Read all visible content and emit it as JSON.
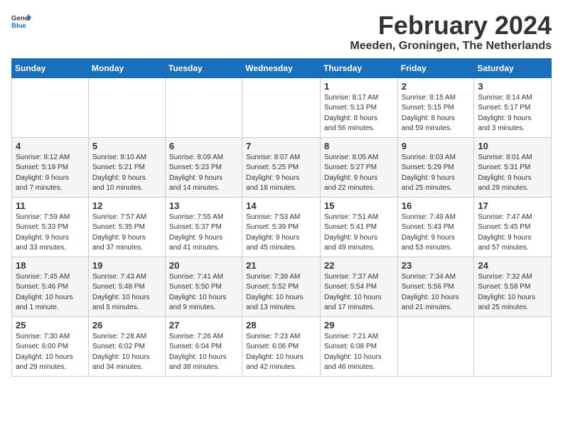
{
  "logo": {
    "general": "General",
    "blue": "Blue"
  },
  "title": "February 2024",
  "subtitle": "Meeden, Groningen, The Netherlands",
  "days_header": [
    "Sunday",
    "Monday",
    "Tuesday",
    "Wednesday",
    "Thursday",
    "Friday",
    "Saturday"
  ],
  "weeks": [
    [
      {
        "num": "",
        "info": ""
      },
      {
        "num": "",
        "info": ""
      },
      {
        "num": "",
        "info": ""
      },
      {
        "num": "",
        "info": ""
      },
      {
        "num": "1",
        "info": "Sunrise: 8:17 AM\nSunset: 5:13 PM\nDaylight: 8 hours\nand 56 minutes."
      },
      {
        "num": "2",
        "info": "Sunrise: 8:15 AM\nSunset: 5:15 PM\nDaylight: 8 hours\nand 59 minutes."
      },
      {
        "num": "3",
        "info": "Sunrise: 8:14 AM\nSunset: 5:17 PM\nDaylight: 9 hours\nand 3 minutes."
      }
    ],
    [
      {
        "num": "4",
        "info": "Sunrise: 8:12 AM\nSunset: 5:19 PM\nDaylight: 9 hours\nand 7 minutes."
      },
      {
        "num": "5",
        "info": "Sunrise: 8:10 AM\nSunset: 5:21 PM\nDaylight: 9 hours\nand 10 minutes."
      },
      {
        "num": "6",
        "info": "Sunrise: 8:09 AM\nSunset: 5:23 PM\nDaylight: 9 hours\nand 14 minutes."
      },
      {
        "num": "7",
        "info": "Sunrise: 8:07 AM\nSunset: 5:25 PM\nDaylight: 9 hours\nand 18 minutes."
      },
      {
        "num": "8",
        "info": "Sunrise: 8:05 AM\nSunset: 5:27 PM\nDaylight: 9 hours\nand 22 minutes."
      },
      {
        "num": "9",
        "info": "Sunrise: 8:03 AM\nSunset: 5:29 PM\nDaylight: 9 hours\nand 25 minutes."
      },
      {
        "num": "10",
        "info": "Sunrise: 8:01 AM\nSunset: 5:31 PM\nDaylight: 9 hours\nand 29 minutes."
      }
    ],
    [
      {
        "num": "11",
        "info": "Sunrise: 7:59 AM\nSunset: 5:33 PM\nDaylight: 9 hours\nand 33 minutes."
      },
      {
        "num": "12",
        "info": "Sunrise: 7:57 AM\nSunset: 5:35 PM\nDaylight: 9 hours\nand 37 minutes."
      },
      {
        "num": "13",
        "info": "Sunrise: 7:55 AM\nSunset: 5:37 PM\nDaylight: 9 hours\nand 41 minutes."
      },
      {
        "num": "14",
        "info": "Sunrise: 7:53 AM\nSunset: 5:39 PM\nDaylight: 9 hours\nand 45 minutes."
      },
      {
        "num": "15",
        "info": "Sunrise: 7:51 AM\nSunset: 5:41 PM\nDaylight: 9 hours\nand 49 minutes."
      },
      {
        "num": "16",
        "info": "Sunrise: 7:49 AM\nSunset: 5:43 PM\nDaylight: 9 hours\nand 53 minutes."
      },
      {
        "num": "17",
        "info": "Sunrise: 7:47 AM\nSunset: 5:45 PM\nDaylight: 9 hours\nand 57 minutes."
      }
    ],
    [
      {
        "num": "18",
        "info": "Sunrise: 7:45 AM\nSunset: 5:46 PM\nDaylight: 10 hours\nand 1 minute."
      },
      {
        "num": "19",
        "info": "Sunrise: 7:43 AM\nSunset: 5:48 PM\nDaylight: 10 hours\nand 5 minutes."
      },
      {
        "num": "20",
        "info": "Sunrise: 7:41 AM\nSunset: 5:50 PM\nDaylight: 10 hours\nand 9 minutes."
      },
      {
        "num": "21",
        "info": "Sunrise: 7:39 AM\nSunset: 5:52 PM\nDaylight: 10 hours\nand 13 minutes."
      },
      {
        "num": "22",
        "info": "Sunrise: 7:37 AM\nSunset: 5:54 PM\nDaylight: 10 hours\nand 17 minutes."
      },
      {
        "num": "23",
        "info": "Sunrise: 7:34 AM\nSunset: 5:56 PM\nDaylight: 10 hours\nand 21 minutes."
      },
      {
        "num": "24",
        "info": "Sunrise: 7:32 AM\nSunset: 5:58 PM\nDaylight: 10 hours\nand 25 minutes."
      }
    ],
    [
      {
        "num": "25",
        "info": "Sunrise: 7:30 AM\nSunset: 6:00 PM\nDaylight: 10 hours\nand 29 minutes."
      },
      {
        "num": "26",
        "info": "Sunrise: 7:28 AM\nSunset: 6:02 PM\nDaylight: 10 hours\nand 34 minutes."
      },
      {
        "num": "27",
        "info": "Sunrise: 7:26 AM\nSunset: 6:04 PM\nDaylight: 10 hours\nand 38 minutes."
      },
      {
        "num": "28",
        "info": "Sunrise: 7:23 AM\nSunset: 6:06 PM\nDaylight: 10 hours\nand 42 minutes."
      },
      {
        "num": "29",
        "info": "Sunrise: 7:21 AM\nSunset: 6:08 PM\nDaylight: 10 hours\nand 46 minutes."
      },
      {
        "num": "",
        "info": ""
      },
      {
        "num": "",
        "info": ""
      }
    ]
  ]
}
